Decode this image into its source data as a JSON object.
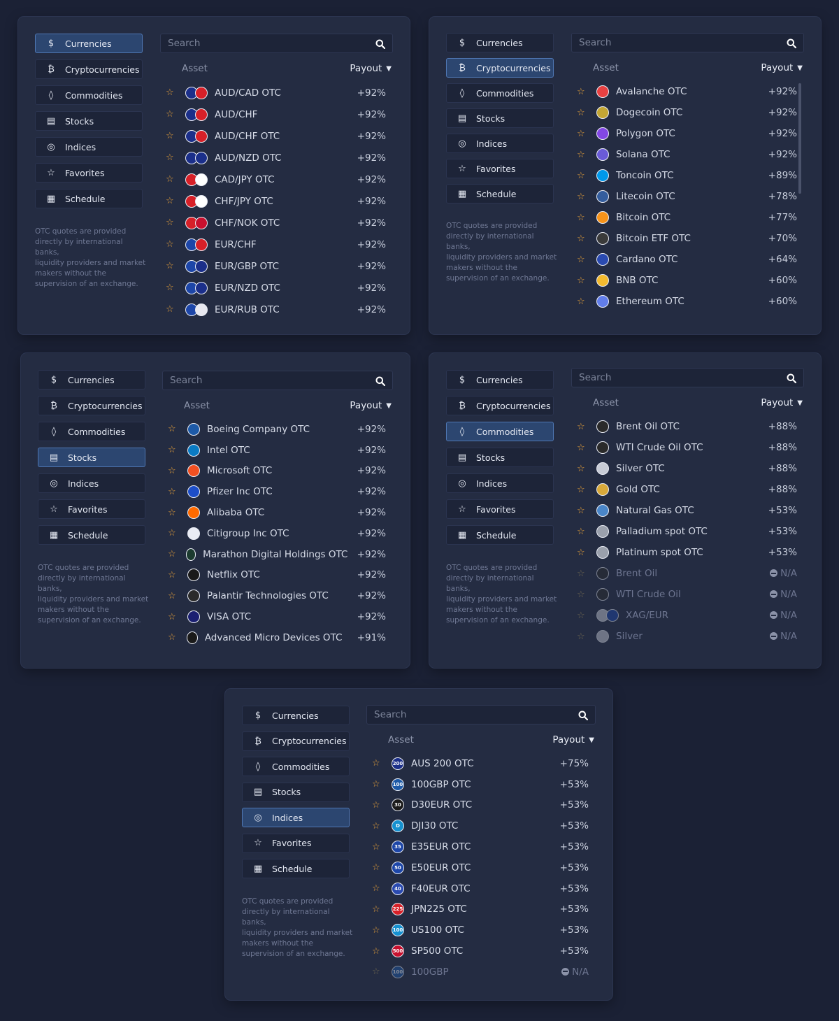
{
  "categories": [
    {
      "label": "Currencies",
      "icon": "dollar-icon",
      "glyph": "$"
    },
    {
      "label": "Cryptocurrencies",
      "icon": "bitcoin-icon",
      "glyph": "₿"
    },
    {
      "label": "Commodities",
      "icon": "drop-icon",
      "glyph": "◊"
    },
    {
      "label": "Stocks",
      "icon": "document-icon",
      "glyph": "▤"
    },
    {
      "label": "Indices",
      "icon": "gauge-icon",
      "glyph": "◎"
    },
    {
      "label": "Favorites",
      "icon": "star-outline-icon",
      "glyph": "☆"
    },
    {
      "label": "Schedule",
      "icon": "calendar-icon",
      "glyph": "▦"
    }
  ],
  "note_lines": [
    "OTC quotes are provided",
    "directly by international banks,",
    "liquidity providers and market",
    "makers without the",
    "supervision of an exchange."
  ],
  "search": {
    "placeholder": "Search"
  },
  "header": {
    "asset": "Asset",
    "payout": "Payout"
  },
  "colors": {
    "accent": "#4f77b3",
    "star": "#e7a13a",
    "panel": "#242c42",
    "background": "#1b2135"
  },
  "panels": [
    {
      "active_category": "Currencies",
      "assets": [
        {
          "name": "AUD/CAD OTC",
          "payout": "+92%",
          "icon": [
            "#1b2f8a",
            "#d72028"
          ]
        },
        {
          "name": "AUD/CHF",
          "payout": "+92%",
          "icon": [
            "#1b2f8a",
            "#d72028"
          ]
        },
        {
          "name": "AUD/CHF OTC",
          "payout": "+92%",
          "icon": [
            "#1b2f8a",
            "#d72028"
          ]
        },
        {
          "name": "AUD/NZD OTC",
          "payout": "+92%",
          "icon": [
            "#1b2f8a",
            "#1b2f8a"
          ]
        },
        {
          "name": "CAD/JPY OTC",
          "payout": "+92%",
          "icon": [
            "#d72028",
            "#ffffff"
          ]
        },
        {
          "name": "CHF/JPY OTC",
          "payout": "+92%",
          "icon": [
            "#d72028",
            "#ffffff"
          ]
        },
        {
          "name": "CHF/NOK OTC",
          "payout": "+92%",
          "icon": [
            "#d72028",
            "#c8102e"
          ]
        },
        {
          "name": "EUR/CHF",
          "payout": "+92%",
          "icon": [
            "#1d46a8",
            "#d72028"
          ]
        },
        {
          "name": "EUR/GBP OTC",
          "payout": "+92%",
          "icon": [
            "#1d46a8",
            "#1b2f8a"
          ]
        },
        {
          "name": "EUR/NZD OTC",
          "payout": "+92%",
          "icon": [
            "#1d46a8",
            "#1b2f8a"
          ]
        },
        {
          "name": "EUR/RUB OTC",
          "payout": "+92%",
          "icon": [
            "#1d46a8",
            "#e8e8f0"
          ]
        }
      ]
    },
    {
      "active_category": "Cryptocurrencies",
      "assets": [
        {
          "name": "Avalanche OTC",
          "payout": "+92%",
          "icon": [
            "#e84142"
          ]
        },
        {
          "name": "Dogecoin OTC",
          "payout": "+92%",
          "icon": [
            "#c3a634"
          ]
        },
        {
          "name": "Polygon OTC",
          "payout": "+92%",
          "icon": [
            "#8247e5"
          ]
        },
        {
          "name": "Solana OTC",
          "payout": "+92%",
          "icon": [
            "#6a5bd8"
          ]
        },
        {
          "name": "Toncoin OTC",
          "payout": "+89%",
          "icon": [
            "#0098ea"
          ]
        },
        {
          "name": "Litecoin OTC",
          "payout": "+78%",
          "icon": [
            "#345d9d"
          ]
        },
        {
          "name": "Bitcoin OTC",
          "payout": "+77%",
          "icon": [
            "#f7931a"
          ]
        },
        {
          "name": "Bitcoin ETF OTC",
          "payout": "+70%",
          "icon": [
            "#3a3a3a"
          ]
        },
        {
          "name": "Cardano OTC",
          "payout": "+64%",
          "icon": [
            "#2a4ab0"
          ]
        },
        {
          "name": "BNB OTC",
          "payout": "+60%",
          "icon": [
            "#f3ba2f"
          ]
        },
        {
          "name": "Ethereum OTC",
          "payout": "+60%",
          "icon": [
            "#627eea"
          ]
        }
      ]
    },
    {
      "active_category": "Stocks",
      "assets": [
        {
          "name": "Boeing Company OTC",
          "payout": "+92%",
          "icon": [
            "#1d5aa8"
          ]
        },
        {
          "name": "Intel OTC",
          "payout": "+92%",
          "icon": [
            "#0a7bc4"
          ]
        },
        {
          "name": "Microsoft OTC",
          "payout": "+92%",
          "icon": [
            "#f25022"
          ]
        },
        {
          "name": "Pfizer Inc OTC",
          "payout": "+92%",
          "icon": [
            "#1d4ec9"
          ]
        },
        {
          "name": "Alibaba OTC",
          "payout": "+92%",
          "icon": [
            "#ff6a00"
          ]
        },
        {
          "name": "Citigroup Inc OTC",
          "payout": "+92%",
          "icon": [
            "#e9ecf4"
          ]
        },
        {
          "name": "Marathon Digital Holdings OTC",
          "payout": "+92%",
          "icon": [
            "#1c3b2f"
          ]
        },
        {
          "name": "Netflix OTC",
          "payout": "+92%",
          "icon": [
            "#1a1a1a"
          ]
        },
        {
          "name": "Palantir Technologies OTC",
          "payout": "+92%",
          "icon": [
            "#2a2a2a"
          ]
        },
        {
          "name": "VISA OTC",
          "payout": "+92%",
          "icon": [
            "#1a1f71"
          ]
        },
        {
          "name": "Advanced Micro Devices OTC",
          "payout": "+91%",
          "icon": [
            "#1a1a1a"
          ]
        }
      ]
    },
    {
      "active_category": "Commodities",
      "assets": [
        {
          "name": "Brent Oil OTC",
          "payout": "+88%",
          "icon": [
            "#2a2a2a"
          ]
        },
        {
          "name": "WTI Crude Oil OTC",
          "payout": "+88%",
          "icon": [
            "#2a2a2a"
          ]
        },
        {
          "name": "Silver OTC",
          "payout": "+88%",
          "icon": [
            "#c8ccd6"
          ]
        },
        {
          "name": "Gold OTC",
          "payout": "+88%",
          "icon": [
            "#d8a93a"
          ]
        },
        {
          "name": "Natural Gas OTC",
          "payout": "+53%",
          "icon": [
            "#4a86c9"
          ]
        },
        {
          "name": "Palladium spot OTC",
          "payout": "+53%",
          "icon": [
            "#9aa0ac"
          ]
        },
        {
          "name": "Platinum spot OTC",
          "payout": "+53%",
          "icon": [
            "#9aa0ac"
          ]
        },
        {
          "name": "Brent Oil",
          "payout": "N/A",
          "disabled": true,
          "icon": [
            "#2a2a2a"
          ]
        },
        {
          "name": "WTI Crude Oil",
          "payout": "N/A",
          "disabled": true,
          "icon": [
            "#2a2a2a"
          ]
        },
        {
          "name": "XAG/EUR",
          "payout": "N/A",
          "disabled": true,
          "icon": [
            "#c8ccd6",
            "#1d46a8"
          ]
        },
        {
          "name": "Silver",
          "payout": "N/A",
          "disabled": true,
          "icon": [
            "#c8ccd6"
          ]
        }
      ]
    },
    {
      "active_category": "Indices",
      "assets": [
        {
          "name": "AUS 200 OTC",
          "payout": "+75%",
          "icon": [
            "#1b2f8a"
          ],
          "label": "200"
        },
        {
          "name": "100GBP OTC",
          "payout": "+53%",
          "icon": [
            "#1d5aa8"
          ],
          "label": "100"
        },
        {
          "name": "D30EUR OTC",
          "payout": "+53%",
          "icon": [
            "#1a1a1a"
          ],
          "label": "30"
        },
        {
          "name": "DJI30 OTC",
          "payout": "+53%",
          "icon": [
            "#1591d0"
          ],
          "label": "D"
        },
        {
          "name": "E35EUR OTC",
          "payout": "+53%",
          "icon": [
            "#1d46a8"
          ],
          "label": "35"
        },
        {
          "name": "E50EUR OTC",
          "payout": "+53%",
          "icon": [
            "#1d46a8"
          ],
          "label": "50"
        },
        {
          "name": "F40EUR OTC",
          "payout": "+53%",
          "icon": [
            "#2a4ab0"
          ],
          "label": "40"
        },
        {
          "name": "JPN225 OTC",
          "payout": "+53%",
          "icon": [
            "#d72028"
          ],
          "label": "225"
        },
        {
          "name": "US100 OTC",
          "payout": "+53%",
          "icon": [
            "#1591d0"
          ],
          "label": "100"
        },
        {
          "name": "SP500 OTC",
          "payout": "+53%",
          "icon": [
            "#c8102e"
          ],
          "label": "500"
        },
        {
          "name": "100GBP",
          "payout": "N/A",
          "disabled": true,
          "icon": [
            "#1d5aa8"
          ],
          "label": "100"
        }
      ]
    }
  ]
}
